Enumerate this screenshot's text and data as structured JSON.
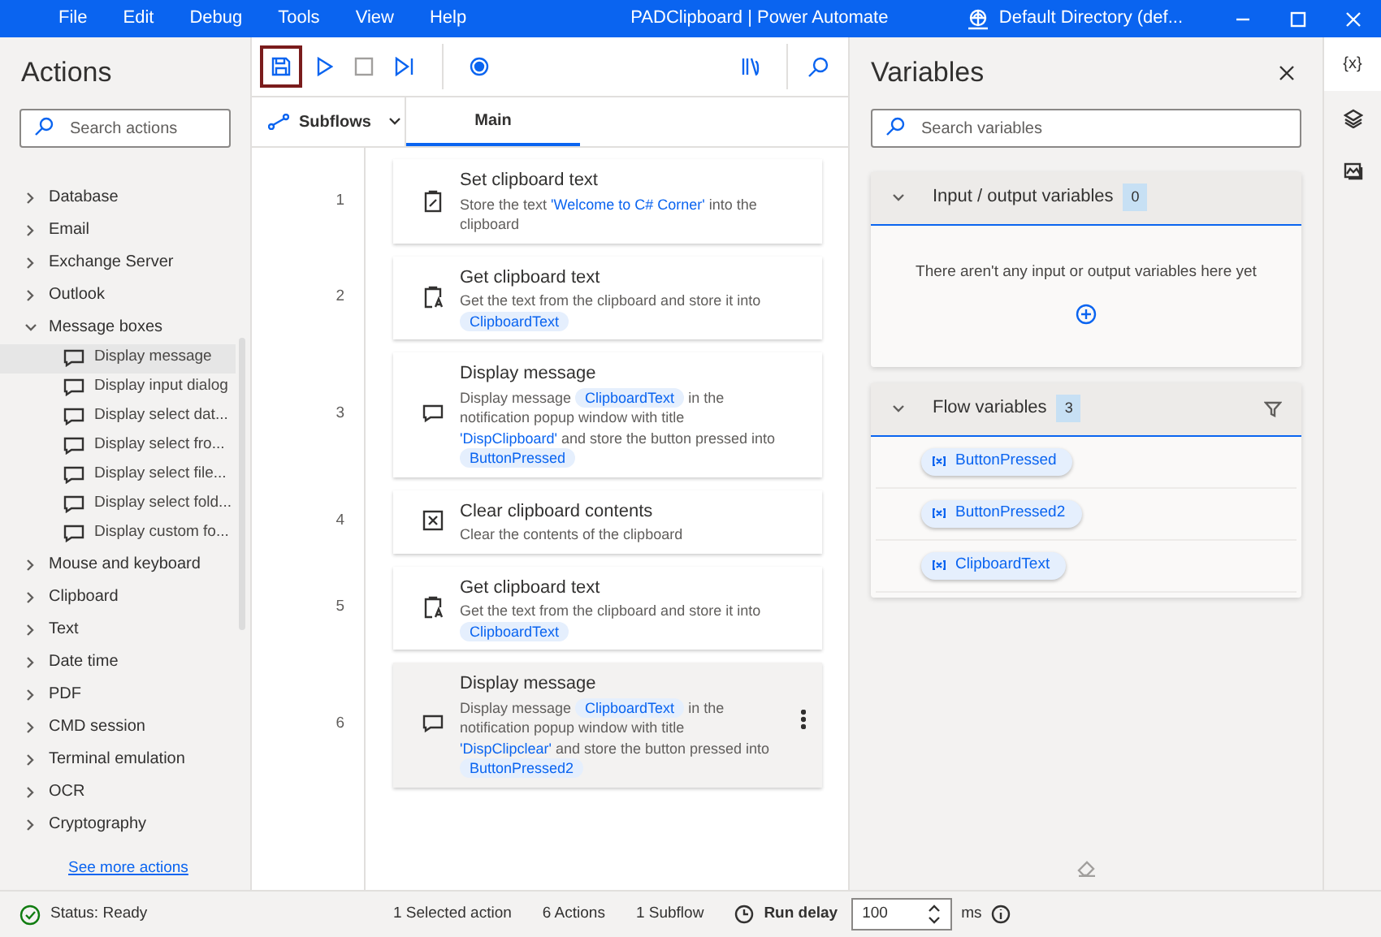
{
  "window": {
    "title": "PADClipboard | Power Automate",
    "directory": "Default Directory (def..."
  },
  "menu": [
    "File",
    "Edit",
    "Debug",
    "Tools",
    "View",
    "Help"
  ],
  "actions_panel": {
    "title": "Actions",
    "search": {
      "placeholder": "Search actions"
    },
    "categories": [
      {
        "label": "Database",
        "expanded": false
      },
      {
        "label": "Email",
        "expanded": false
      },
      {
        "label": "Exchange Server",
        "expanded": false
      },
      {
        "label": "Outlook",
        "expanded": false
      },
      {
        "label": "Message boxes",
        "expanded": true,
        "children": [
          {
            "label": "Display message",
            "selected": true
          },
          {
            "label": "Display input dialog",
            "selected": false
          },
          {
            "label": "Display select dat...",
            "selected": false
          },
          {
            "label": "Display select fro...",
            "selected": false
          },
          {
            "label": "Display select file...",
            "selected": false
          },
          {
            "label": "Display select fold...",
            "selected": false
          },
          {
            "label": "Display custom fo...",
            "selected": false
          }
        ]
      },
      {
        "label": "Mouse and keyboard",
        "expanded": false
      },
      {
        "label": "Clipboard",
        "expanded": false
      },
      {
        "label": "Text",
        "expanded": false
      },
      {
        "label": "Date time",
        "expanded": false
      },
      {
        "label": "PDF",
        "expanded": false
      },
      {
        "label": "CMD session",
        "expanded": false
      },
      {
        "label": "Terminal emulation",
        "expanded": false
      },
      {
        "label": "OCR",
        "expanded": false
      },
      {
        "label": "Cryptography",
        "expanded": false
      }
    ],
    "more_link": "See more actions"
  },
  "toolbar": {
    "subflows": "Subflows",
    "tabs": [
      {
        "label": "Main",
        "selected": true
      }
    ]
  },
  "steps": [
    {
      "number": "1",
      "kind": "set",
      "title": "Set clipboard text",
      "selected": false,
      "description": [
        {
          "kind": "text",
          "text": "Store the text "
        },
        {
          "kind": "string",
          "text": "'Welcome to C# Corner'"
        },
        {
          "kind": "text",
          "text": " into the clipboard"
        }
      ]
    },
    {
      "number": "2",
      "kind": "get",
      "title": "Get clipboard text",
      "selected": false,
      "description": [
        {
          "kind": "text",
          "text": "Get the text from the clipboard and store it into "
        },
        {
          "kind": "variable",
          "text": "ClipboardText"
        }
      ]
    },
    {
      "number": "3",
      "kind": "message",
      "title": "Display message",
      "selected": false,
      "description": [
        {
          "kind": "text",
          "text": "Display message "
        },
        {
          "kind": "variable",
          "text": "ClipboardText"
        },
        {
          "kind": "text",
          "text": " in the notification popup window with title "
        },
        {
          "kind": "string",
          "text": "'DispClipboard'"
        },
        {
          "kind": "text",
          "text": " and store the button pressed into "
        },
        {
          "kind": "variable",
          "text": "ButtonPressed"
        }
      ]
    },
    {
      "number": "4",
      "kind": "clear",
      "title": "Clear clipboard contents",
      "selected": false,
      "description": [
        {
          "kind": "text",
          "text": "Clear the contents of the clipboard"
        }
      ]
    },
    {
      "number": "5",
      "kind": "get",
      "title": "Get clipboard text",
      "selected": false,
      "description": [
        {
          "kind": "text",
          "text": "Get the text from the clipboard and store it into "
        },
        {
          "kind": "variable",
          "text": "ClipboardText"
        }
      ]
    },
    {
      "number": "6",
      "kind": "message",
      "title": "Display message",
      "selected": true,
      "description": [
        {
          "kind": "text",
          "text": "Display message "
        },
        {
          "kind": "variable",
          "text": "ClipboardText"
        },
        {
          "kind": "text",
          "text": " in the notification popup window with title "
        },
        {
          "kind": "string",
          "text": "'DispClipclear'"
        },
        {
          "kind": "text",
          "text": " and store the button pressed into "
        },
        {
          "kind": "variable",
          "text": "ButtonPressed2"
        }
      ]
    }
  ],
  "variables_panel": {
    "title": "Variables",
    "search": {
      "placeholder": "Search variables"
    },
    "io_section": {
      "title": "Input / output variables",
      "count": "0",
      "expanded": true,
      "empty_text": "There aren't any input or output variables here yet"
    },
    "flow_section": {
      "title": "Flow variables",
      "count": "3",
      "expanded": true,
      "items": [
        "ButtonPressed",
        "ButtonPressed2",
        "ClipboardText"
      ]
    }
  },
  "side_tabs": [
    {
      "label": "{x}",
      "selected": true
    }
  ],
  "status_bar": {
    "status": "Status: Ready",
    "selected": "1 Selected action",
    "actions": "6 Actions",
    "subflows": "1 Subflow",
    "run_delay_label": "Run delay",
    "run_delay": "100",
    "unit": "ms"
  }
}
